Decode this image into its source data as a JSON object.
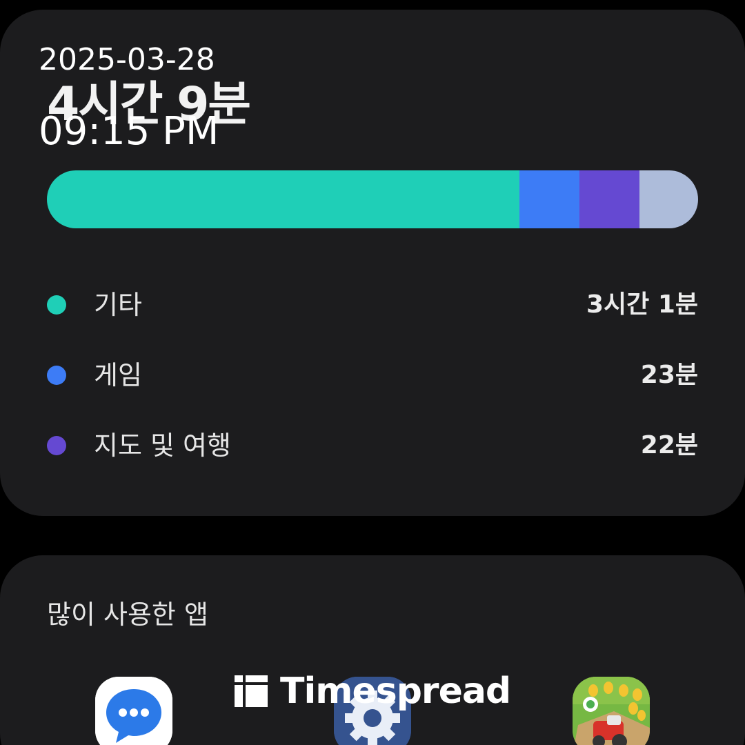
{
  "overlay": {
    "date": "2025-03-28",
    "time": "09:15 PM"
  },
  "usage": {
    "total_time": "4시간 9분",
    "bar": [
      {
        "category": "기타",
        "fraction": 0.726,
        "color": "#1fcfb7"
      },
      {
        "category": "게임",
        "fraction": 0.092,
        "color": "#3d7cf6"
      },
      {
        "category": "지도 및 여행",
        "fraction": 0.092,
        "color": "#6549d2"
      },
      {
        "category": "rest",
        "fraction": 0.09,
        "color": "#adbcda"
      }
    ],
    "legend": [
      {
        "label": "기타",
        "value": "3시간 1분",
        "color": "#1fcfb7"
      },
      {
        "label": "게임",
        "value": "23분",
        "color": "#3d7cf6"
      },
      {
        "label": "지도 및 여행",
        "value": "22분",
        "color": "#6549d2"
      }
    ]
  },
  "apps": {
    "title": "많이 사용한 앱",
    "icons": [
      "messages-icon",
      "settings-icon",
      "farm-game-icon"
    ]
  },
  "watermark": {
    "text": "Timespread"
  },
  "colors": {
    "background": "#000000",
    "card": "#1c1c1e"
  }
}
